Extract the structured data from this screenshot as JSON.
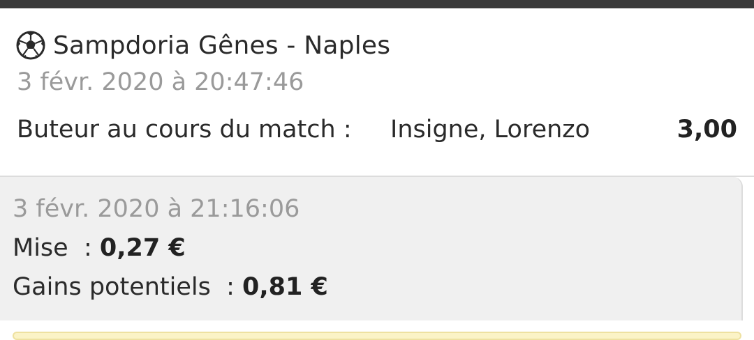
{
  "bet": {
    "sport_icon": "soccer-ball-icon",
    "match_title": "Sampdoria Gênes - Naples",
    "date": "3 févr. 2020 à 20:47:46",
    "market_label": "Buteur au cours du match :",
    "selection": "Insigne, Lorenzo",
    "odds": "3,00"
  },
  "summary": {
    "date": "3 févr. 2020 à 21:16:06",
    "stake_label": "Mise  : ",
    "stake_value": "0,27 €",
    "gain_label": "Gains potentiels  : ",
    "gain_value": "0,81 €"
  },
  "colors": {
    "top_bar": "#3a3a3a",
    "muted_text": "#9a9a9a",
    "panel_bg": "#f0f0f0",
    "highlight": "#fbf3c6"
  }
}
